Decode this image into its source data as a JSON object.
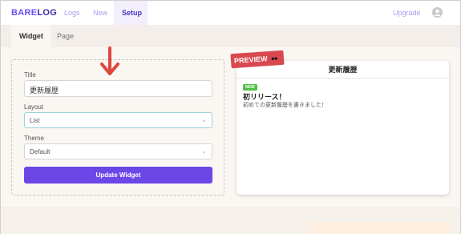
{
  "topnav": {
    "logo_part1": "BARE",
    "logo_part2": "LOG",
    "links": [
      "Logs",
      "New",
      "Setup"
    ],
    "upgrade": "Upgrade",
    "avatar_icon": "user-circle-icon"
  },
  "subtabs": [
    "Widget",
    "Page"
  ],
  "form": {
    "title_label": "Title",
    "title_value": "更新履歴",
    "layout_label": "Layout",
    "layout_value": "List",
    "theme_label": "Theme",
    "theme_value": "Default",
    "update_button": "Update Widget"
  },
  "preview": {
    "ribbon": "PREVIEW",
    "header": "更新履歴",
    "badge": "NEW",
    "entry_title": "初リリース！",
    "entry_body": "初めての更新履歴を書きました！"
  },
  "colors": {
    "accent": "#6c47e8",
    "ribbon": "#d9484f",
    "badge": "#4fbf46",
    "annotation_arrow": "#e0453f"
  }
}
